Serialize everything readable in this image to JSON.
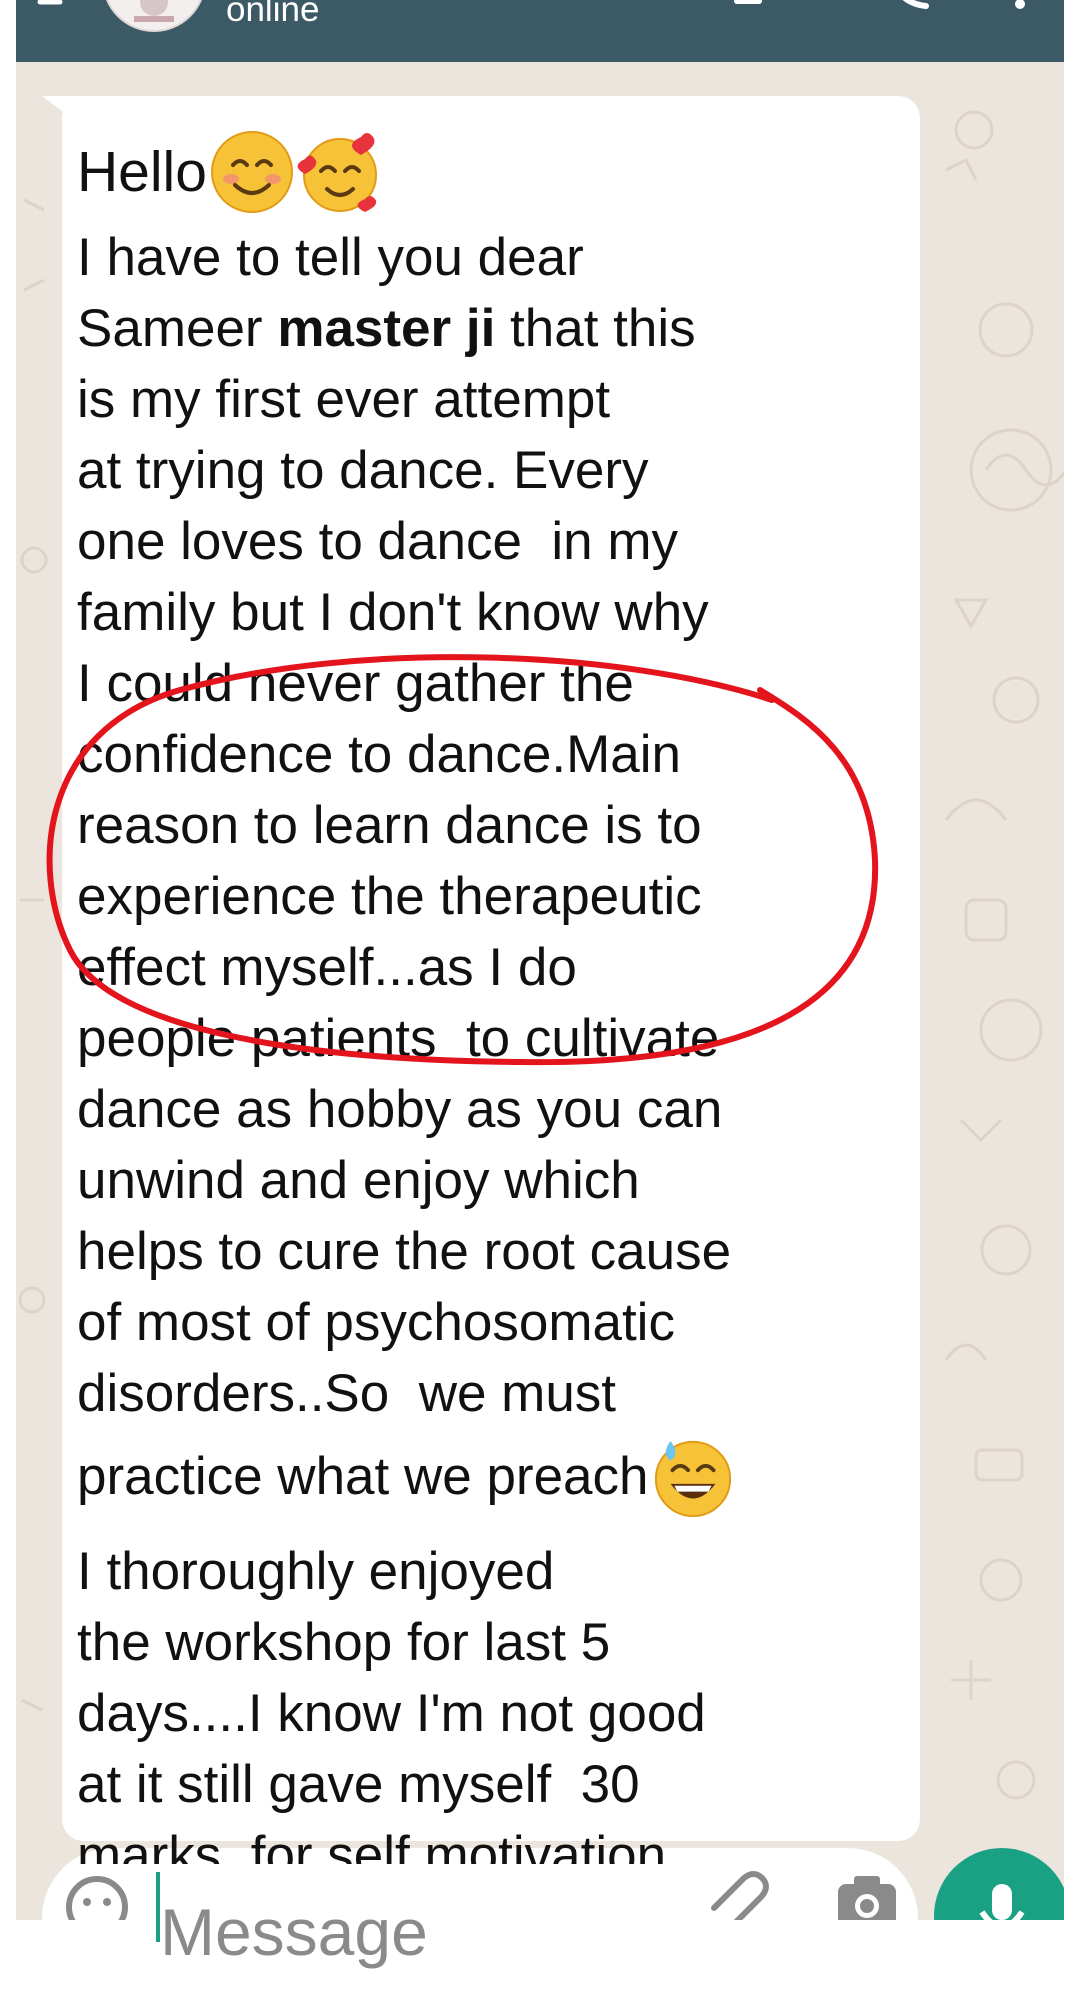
{
  "header": {
    "status": "online"
  },
  "message": {
    "greeting": "Hello",
    "lines": [
      "I have to tell you dear",
      "Sameer ",
      "master ji",
      " that this",
      "is my first ever attempt",
      "at trying to dance. Every",
      "one loves to dance  in my",
      "family but I don't know why",
      "I could never gather the",
      "confidence to dance.Main",
      "reason to learn dance is to",
      "experience the therapeutic",
      "effect myself...as I do",
      "people patients  to cultivate",
      "dance as hobby as you can",
      "unwind and enjoy which",
      "helps to cure the root cause",
      "of most of psychosomatic",
      "disorders..So  we must",
      "practice what we preach",
      "I thoroughly enjoyed",
      "the workshop for last 5",
      "days....I know I'm not good",
      "at it still gave myself  30",
      "marks  for self motivation"
    ]
  },
  "composer": {
    "placeholder": "Message"
  },
  "icons": {
    "back": "back-arrow-icon",
    "emoji": "emoji-icon",
    "attach": "paperclip-icon",
    "camera": "camera-icon",
    "mic": "microphone-icon"
  },
  "colors": {
    "header": "#3c5a66",
    "chat_background": "#ece5dd",
    "bubble": "#ffffff",
    "accent": "#1aa184",
    "annotation": "#e3141c"
  }
}
